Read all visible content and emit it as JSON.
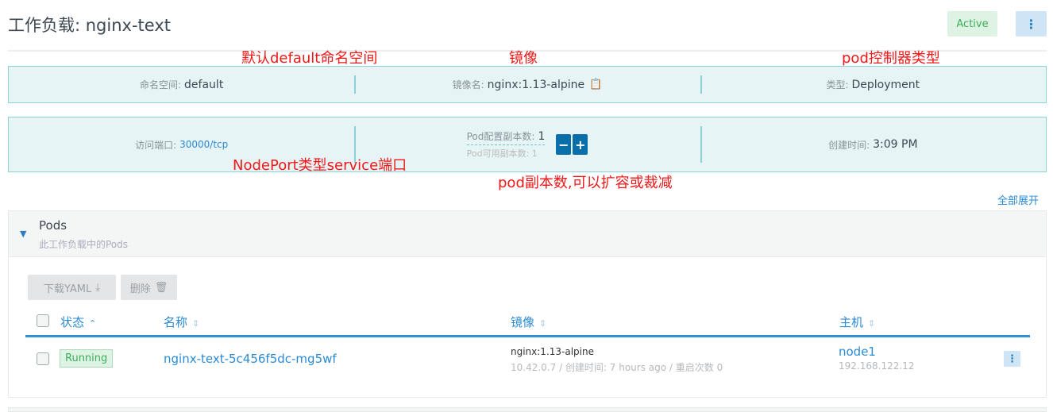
{
  "header": {
    "title": "工作负载: nginx-text",
    "status": "Active",
    "menu_icon": "vertical-dots-icon"
  },
  "annotations": {
    "namespace": "默认default命名空间",
    "image": "镜像",
    "type": "pod控制器类型",
    "port": "NodePort类型service端口",
    "replicas": "pod副本数,可以扩容或裁减"
  },
  "info": {
    "namespace_label": "命名空间:",
    "namespace": "default",
    "image_label": "镜像名:",
    "image": "nginx:1.13-alpine",
    "type_label": "类型:",
    "type": "Deployment",
    "port_label": "访问端口:",
    "port": "30000/tcp",
    "replicas_label": "Pod配置副本数:",
    "replicas": "1",
    "available_label": "Pod可用副本数:",
    "available": "1",
    "minus": "−",
    "plus": "+",
    "created_label": "创建时间:",
    "created": "3:09 PM"
  },
  "expand_all": "全部展开",
  "pods": {
    "title": "Pods",
    "subtitle": "此工作负载中的Pods",
    "download": "下载YAML",
    "delete": "删除",
    "columns": [
      "状态",
      "名称",
      "镜像",
      "主机"
    ],
    "rows": [
      {
        "status": "Running",
        "name": "nginx-text-5c456f5dc-mg5wf",
        "image": "nginx:1.13-alpine",
        "detail": "10.42.0.7 / 创建时间: 7 hours ago / 重启次数 0",
        "node": "node1",
        "ip": "192.168.122.12"
      }
    ]
  },
  "colors": {
    "accent": "#2a8ad4",
    "active": "#3aae5a",
    "annotation": "#f01818",
    "info_bg": "#e6f4f5"
  }
}
